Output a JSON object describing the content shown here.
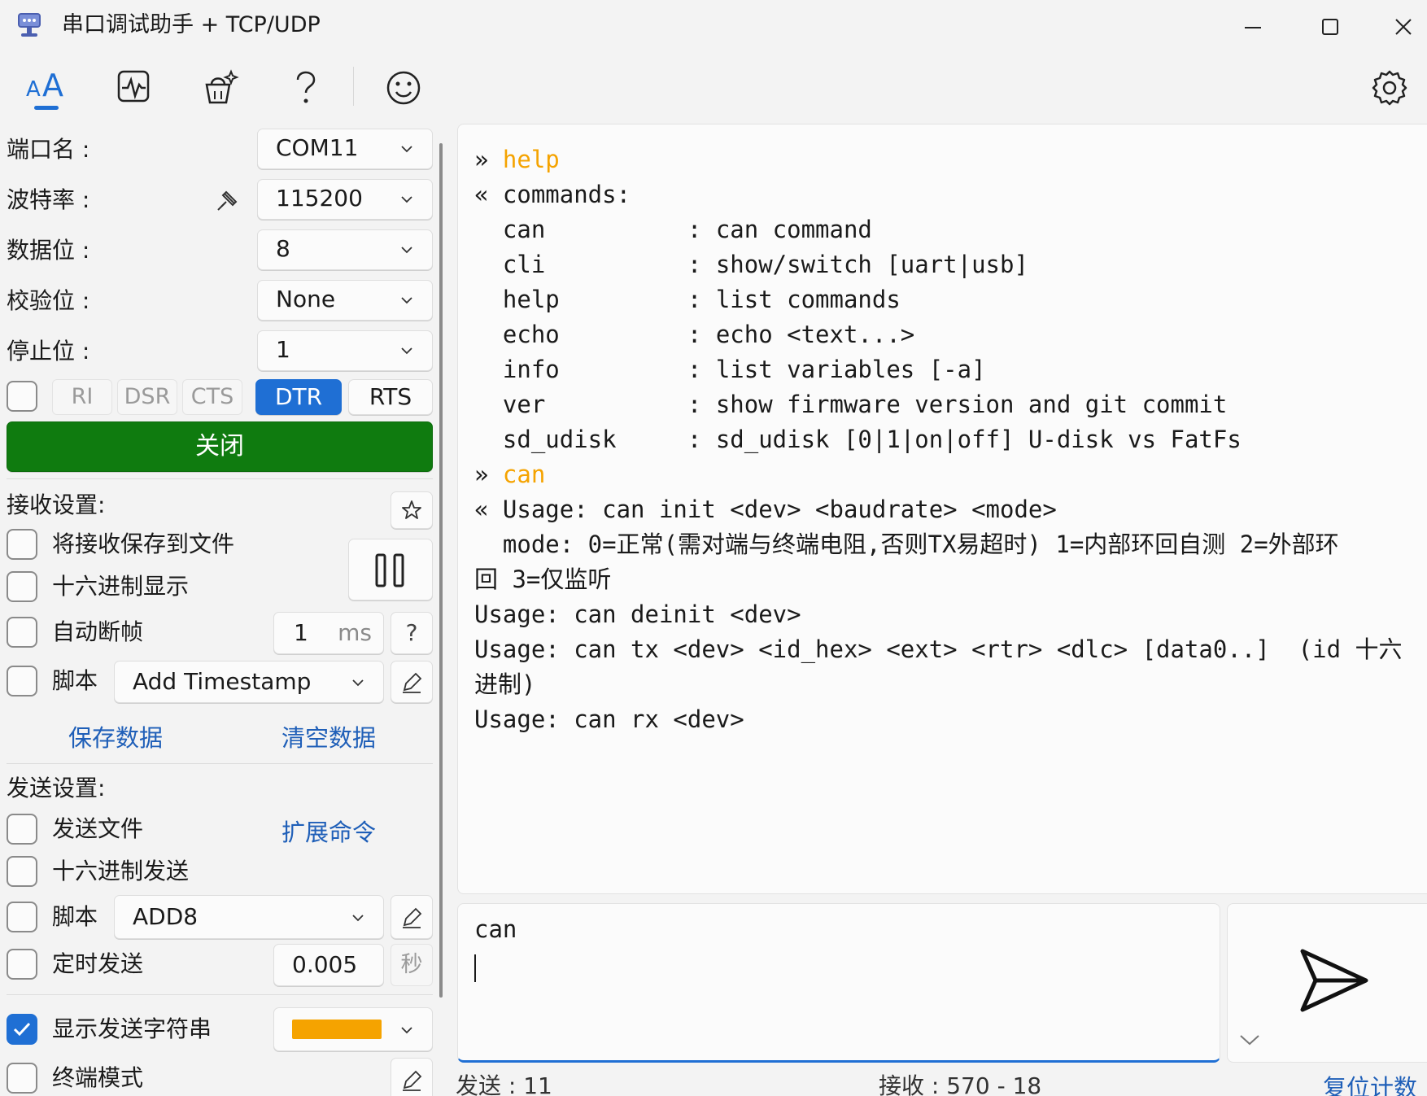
{
  "window": {
    "title": "串口调试助手 + TCP/UDP"
  },
  "toolbar": {
    "icons": [
      "font-icon",
      "waveform-icon",
      "cleanup-icon",
      "help-icon",
      "smiley-icon"
    ],
    "settings_icon": "gear-icon"
  },
  "serial": {
    "port_label": "端口名 :",
    "port_value": "COM11",
    "baud_label": "波特率 :",
    "baud_value": "115200",
    "databits_label": "数据位 :",
    "databits_value": "8",
    "parity_label": "校验位 :",
    "parity_value": "None",
    "stopbits_label": "停止位 :",
    "stopbits_value": "1",
    "signals": {
      "ri": "RI",
      "dsr": "DSR",
      "cts": "CTS",
      "dtr": "DTR",
      "rts": "RTS"
    },
    "close_button": "关闭"
  },
  "receive": {
    "title": "接收设置:",
    "save_to_file": "将接收保存到文件",
    "hex_display": "十六进制显示",
    "auto_frame": "自动断帧",
    "auto_frame_value": "1",
    "auto_frame_unit": "ms",
    "auto_frame_help": "?",
    "script_label": "脚本",
    "script_value": "Add Timestamp",
    "save_data": "保存数据",
    "clear_data": "清空数据"
  },
  "send": {
    "title": "发送设置:",
    "send_file": "发送文件",
    "ext_cmd": "扩展命令",
    "hex_send": "十六进制发送",
    "script_label": "脚本",
    "script_value": "ADD8",
    "timer_send": "定时发送",
    "timer_value": "0.005",
    "timer_unit": "秒",
    "show_send_string": "显示发送字符串",
    "show_send_color": "#f5a300",
    "terminal_mode": "终端模式"
  },
  "terminal": {
    "lines": [
      {
        "prefix": "» ",
        "text": "help",
        "echo": true
      },
      {
        "prefix": "« ",
        "text": "commands:"
      },
      {
        "prefix": "  ",
        "text": "can          : can command"
      },
      {
        "prefix": "  ",
        "text": "cli          : show/switch [uart|usb]"
      },
      {
        "prefix": "  ",
        "text": "help         : list commands"
      },
      {
        "prefix": "  ",
        "text": "echo         : echo <text...>"
      },
      {
        "prefix": "  ",
        "text": "info         : list variables [-a]"
      },
      {
        "prefix": "  ",
        "text": "ver          : show firmware version and git commit"
      },
      {
        "prefix": "  ",
        "text": "sd_udisk     : sd_udisk [0|1|on|off] U-disk vs FatFs"
      },
      {
        "prefix": "» ",
        "text": "can",
        "echo": true
      },
      {
        "prefix": "« ",
        "text": "Usage: can init <dev> <baudrate> <mode>"
      },
      {
        "prefix": "  ",
        "text": "mode: 0=正常(需对端与终端电阻,否则TX易超时) 1=内部环回自测 2=外部环"
      },
      {
        "prefix": "",
        "text": "回 3=仅监听"
      },
      {
        "prefix": "",
        "text": "Usage: can deinit <dev>"
      },
      {
        "prefix": "",
        "text": "Usage: can tx <dev> <id_hex> <ext> <rtr> <dlc> [data0..]  (id 十六"
      },
      {
        "prefix": "",
        "text": "进制)"
      },
      {
        "prefix": "",
        "text": "Usage: can rx <dev>"
      }
    ]
  },
  "input": {
    "text": "can"
  },
  "status": {
    "sent_label": "发送 : 11",
    "recv_label": "接收 : 570 - 18",
    "reset_count": "复位计数"
  }
}
